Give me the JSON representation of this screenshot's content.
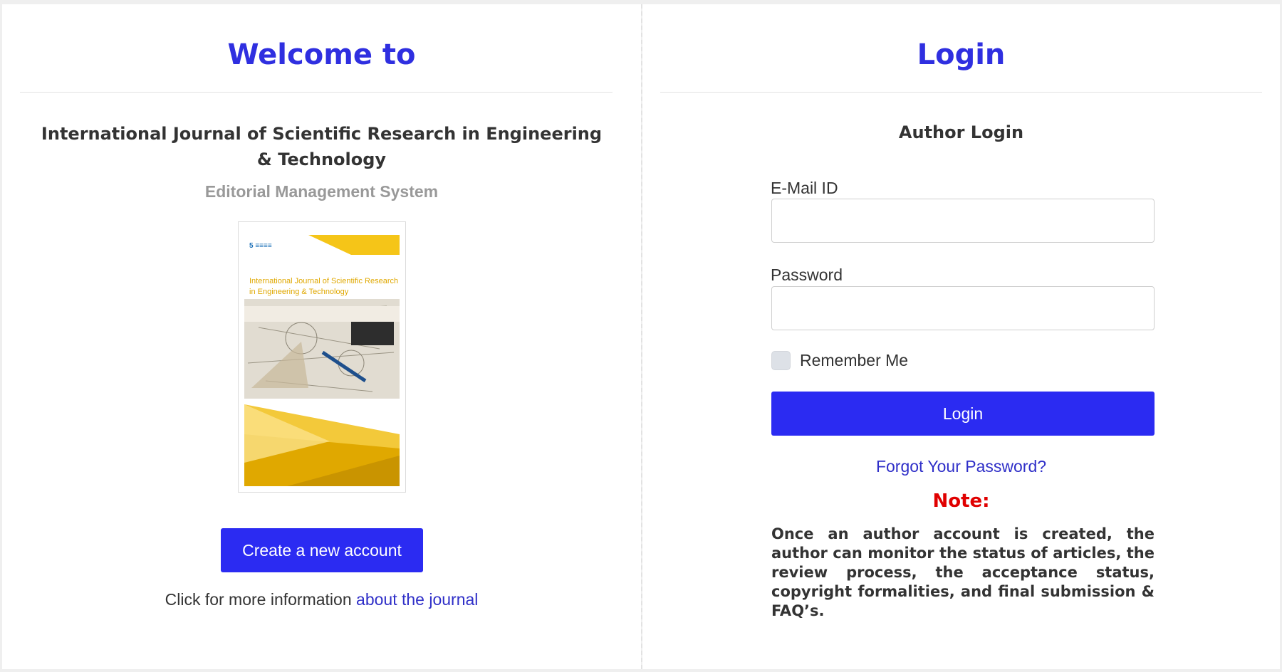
{
  "left": {
    "heading": "Welcome to",
    "journal_title": "International Journal of Scientific Research in Engineering & Technology",
    "subtitle": "Editorial Management System",
    "cover": {
      "title": "International Journal of Scientific Research in Engineering & Technology",
      "logo_text": "5 ≡≡≡≡"
    },
    "create_account_label": "Create a new account",
    "info_prefix": "Click for more information",
    "info_link": "about the journal"
  },
  "right": {
    "heading": "Login",
    "section_title": "Author Login",
    "email": {
      "label": "E-Mail ID",
      "value": "",
      "placeholder": ""
    },
    "password": {
      "label": "Password",
      "value": "",
      "placeholder": ""
    },
    "remember_label": "Remember Me",
    "remember_checked": false,
    "login_label": "Login",
    "forgot_label": "Forgot Your Password?",
    "note_title": "Note:",
    "note_body": "Once an author account is created, the author can monitor the status of articles, the review process, the acceptance status, copyright formalities, and final submission & FAQ’s."
  },
  "colors": {
    "accent": "#2b2bf2",
    "heading": "#2f2fe0",
    "note": "#e00000",
    "link": "#2f2fc8"
  }
}
